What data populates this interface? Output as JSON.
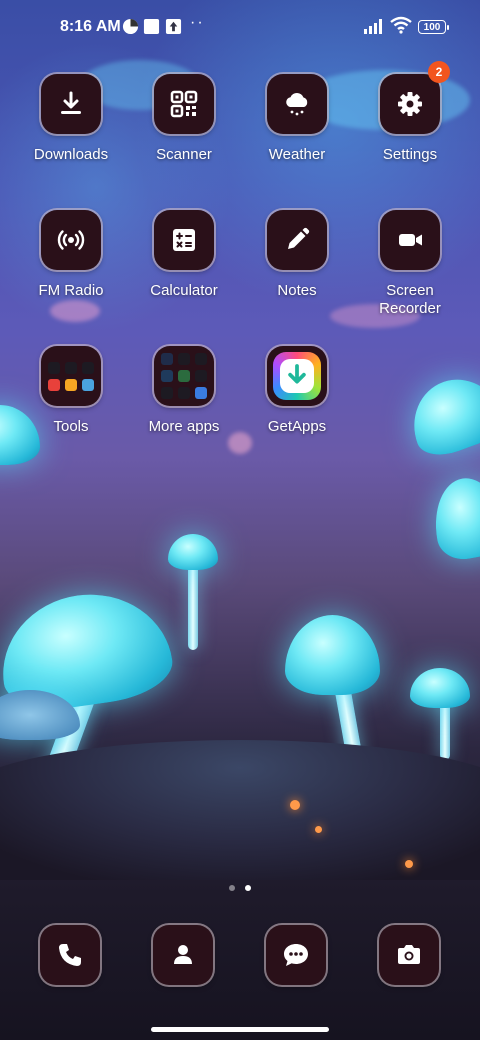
{
  "status_bar": {
    "time": "8:16 AM",
    "battery": "100",
    "notification_icons": [
      "data-saver-icon",
      "square-app-icon",
      "upload-box-icon"
    ],
    "more_indicator": "··"
  },
  "apps": {
    "downloads": {
      "label": "Downloads",
      "icon": "download-icon"
    },
    "scanner": {
      "label": "Scanner",
      "icon": "qr-code-icon"
    },
    "weather": {
      "label": "Weather",
      "icon": "cloud-rain-icon"
    },
    "settings": {
      "label": "Settings",
      "icon": "gear-icon",
      "badge": "2"
    },
    "fm_radio": {
      "label": "FM Radio",
      "icon": "radio-waves-icon"
    },
    "calculator": {
      "label": "Calculator",
      "icon": "calculator-icon"
    },
    "notes": {
      "label": "Notes",
      "icon": "pencil-icon"
    },
    "screen_recorder": {
      "label": "Screen Recorder",
      "icon": "video-camera-icon"
    },
    "tools": {
      "label": "Tools",
      "icon": "folder-icon"
    },
    "more_apps": {
      "label": "More apps",
      "icon": "folder-icon"
    },
    "getapps": {
      "label": "GetApps",
      "icon": "getapps-icon"
    }
  },
  "pager": {
    "pages": 2,
    "active": 2
  },
  "dock": [
    {
      "name": "phone",
      "icon": "phone-icon"
    },
    {
      "name": "contacts",
      "icon": "person-icon"
    },
    {
      "name": "messages",
      "icon": "chat-bubble-icon"
    },
    {
      "name": "camera",
      "icon": "camera-icon"
    }
  ],
  "colors": {
    "tile_bg": "#2a1019",
    "badge": "#f2551e",
    "mushroom_glow": "#6fe9f5"
  }
}
